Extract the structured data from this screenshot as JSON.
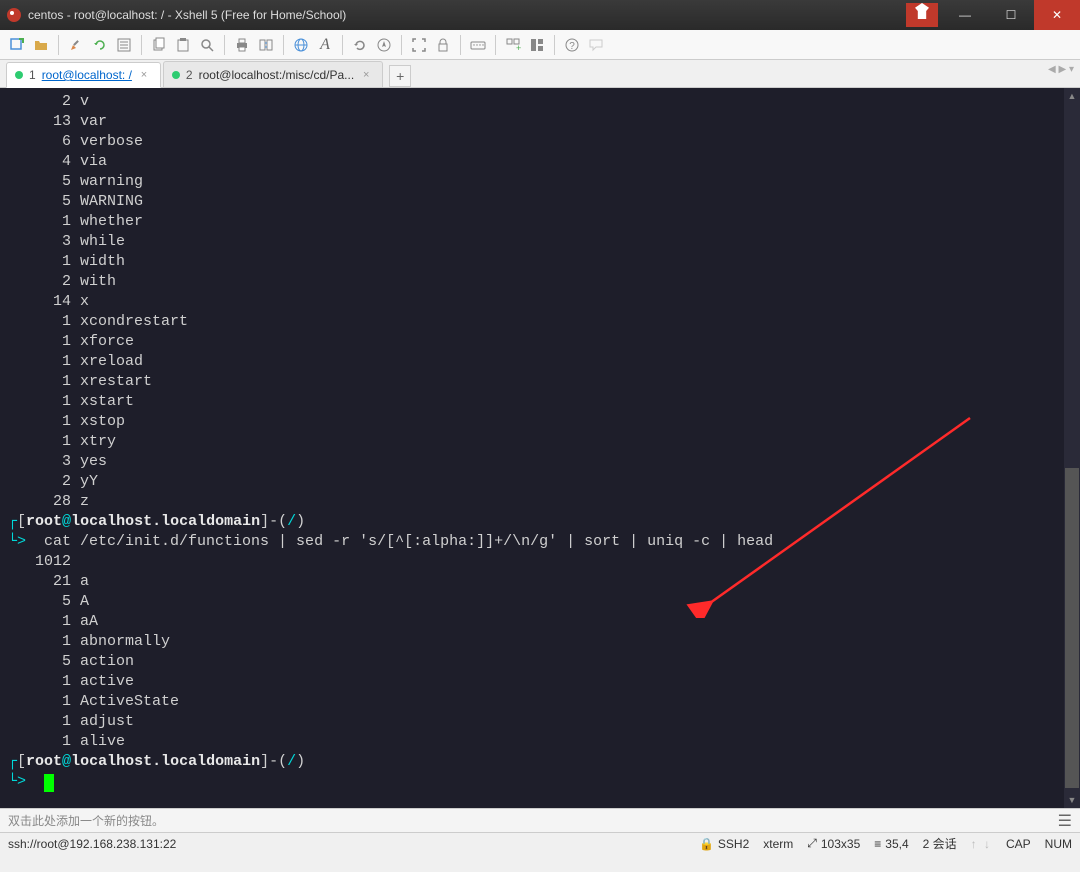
{
  "window": {
    "title": "centos - root@localhost: / - Xshell 5 (Free for Home/School)",
    "minimize": "—",
    "maximize": "☐",
    "close": "✕"
  },
  "tabs": {
    "items": [
      {
        "n": "1",
        "label": "root@localhost: /"
      },
      {
        "n": "2",
        "label": "root@localhost:/misc/cd/Pa..."
      }
    ],
    "add": "+"
  },
  "terminal": {
    "output1": [
      {
        "count": "2",
        "word": "v"
      },
      {
        "count": "13",
        "word": "var"
      },
      {
        "count": "6",
        "word": "verbose"
      },
      {
        "count": "4",
        "word": "via"
      },
      {
        "count": "5",
        "word": "warning"
      },
      {
        "count": "5",
        "word": "WARNING"
      },
      {
        "count": "1",
        "word": "whether"
      },
      {
        "count": "3",
        "word": "while"
      },
      {
        "count": "1",
        "word": "width"
      },
      {
        "count": "2",
        "word": "with"
      },
      {
        "count": "14",
        "word": "x"
      },
      {
        "count": "1",
        "word": "xcondrestart"
      },
      {
        "count": "1",
        "word": "xforce"
      },
      {
        "count": "1",
        "word": "xreload"
      },
      {
        "count": "1",
        "word": "xrestart"
      },
      {
        "count": "1",
        "word": "xstart"
      },
      {
        "count": "1",
        "word": "xstop"
      },
      {
        "count": "1",
        "word": "xtry"
      },
      {
        "count": "3",
        "word": "yes"
      },
      {
        "count": "2",
        "word": "yY"
      },
      {
        "count": "28",
        "word": "z"
      }
    ],
    "prompt1": {
      "lb": "[",
      "user": "root",
      "at": "@",
      "host": "localhost.localdomain",
      "rb": "]-(",
      "path": "/",
      "end": ")"
    },
    "cmd1": "cat /etc/init.d/functions | sed -r 's/[^[:alpha:]]+/\\n/g' | sort | uniq -c | head",
    "output2_first": "   1012 ",
    "output2": [
      {
        "count": "21",
        "word": "a"
      },
      {
        "count": "5",
        "word": "A"
      },
      {
        "count": "1",
        "word": "aA"
      },
      {
        "count": "1",
        "word": "abnormally"
      },
      {
        "count": "5",
        "word": "action"
      },
      {
        "count": "1",
        "word": "active"
      },
      {
        "count": "1",
        "word": "ActiveState"
      },
      {
        "count": "1",
        "word": "adjust"
      },
      {
        "count": "1",
        "word": "alive"
      }
    ],
    "prompt2": {
      "lb": "[",
      "user": "root",
      "at": "@",
      "host": "localhost.localdomain",
      "rb": "]-(",
      "path": "/",
      "end": ")"
    },
    "caret": ">"
  },
  "btnbar": {
    "hint": "双击此处添加一个新的按钮。"
  },
  "status": {
    "conn": "ssh://root@192.168.238.131:22",
    "proto": "SSH2",
    "term": "xterm",
    "size": "103x35",
    "cursor": "35,4",
    "sessions": "2 会话",
    "cap": "CAP",
    "num": "NUM"
  }
}
